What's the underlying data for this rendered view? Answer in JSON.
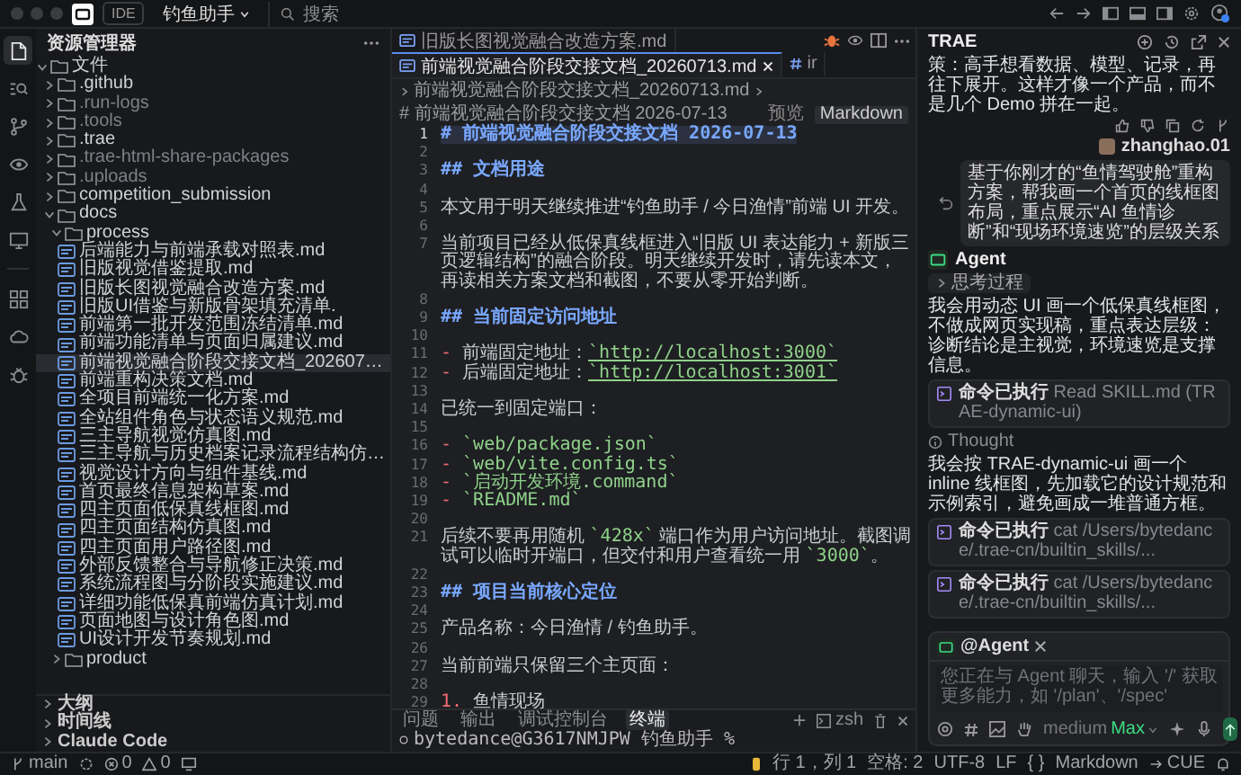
{
  "titlebar": {
    "tag": "IDE",
    "project": "钓鱼助手",
    "search": "搜索"
  },
  "activity_bar": [
    {
      "selected": true
    },
    {
      "selected": false
    },
    {
      "selected": false
    },
    {
      "selected": false
    },
    {
      "selected": false
    },
    {
      "selected": false
    },
    {
      "selected": false
    },
    {
      "selected": false
    },
    {
      "selected": false
    }
  ],
  "sidebar": {
    "title": "资源管理器",
    "tree": [
      {
        "name": "文件",
        "kind": "folder",
        "expanded": true,
        "selected": false,
        "ignored": false,
        "children": [
          {
            "name": ".github",
            "kind": "folder",
            "expanded": false,
            "selected": false,
            "ignored": false
          },
          {
            "name": ".run-logs",
            "kind": "folder",
            "expanded": false,
            "selected": false,
            "ignored": true
          },
          {
            "name": ".tools",
            "kind": "folder",
            "expanded": false,
            "selected": false,
            "ignored": true
          },
          {
            "name": ".trae",
            "kind": "folder",
            "expanded": false,
            "selected": false,
            "ignored": false
          },
          {
            "name": ".trae-html-share-packages",
            "kind": "folder",
            "expanded": false,
            "selected": false,
            "ignored": true
          },
          {
            "name": ".uploads",
            "kind": "folder",
            "expanded": false,
            "selected": false,
            "ignored": true
          },
          {
            "name": "competition_submission",
            "kind": "folder",
            "expanded": false,
            "selected": false,
            "ignored": false
          },
          {
            "name": "docs",
            "kind": "folder",
            "expanded": true,
            "selected": false,
            "ignored": false,
            "children": [
              {
                "name": "process",
                "kind": "folder",
                "expanded": true,
                "selected": false,
                "ignored": false,
                "children": [
                  {
                    "name": "后端能力与前端承载对照表.md",
                    "kind": "file",
                    "selected": false,
                    "ignored": false
                  },
                  {
                    "name": "旧版视觉借鉴提取.md",
                    "kind": "file",
                    "selected": false,
                    "ignored": false
                  },
                  {
                    "name": "旧版长图视觉融合改造方案.md",
                    "kind": "file",
                    "selected": false,
                    "ignored": false
                  },
                  {
                    "name": "旧版UI借鉴与新版骨架填充清单.",
                    "kind": "file",
                    "selected": false,
                    "ignored": false
                  },
                  {
                    "name": "前端第一批开发范围冻结清单.md",
                    "kind": "file",
                    "selected": false,
                    "ignored": false
                  },
                  {
                    "name": "前端功能清单与页面归属建议.md",
                    "kind": "file",
                    "selected": false,
                    "ignored": false
                  },
                  {
                    "name": "前端视觉融合阶段交接文档_202607…",
                    "kind": "file",
                    "selected": true,
                    "ignored": false
                  },
                  {
                    "name": "前端重构决策文档.md",
                    "kind": "file",
                    "selected": false,
                    "ignored": false
                  },
                  {
                    "name": "全项目前端统一化方案.md",
                    "kind": "file",
                    "selected": false,
                    "ignored": false
                  },
                  {
                    "name": "全站组件角色与状态语义规范.md",
                    "kind": "file",
                    "selected": false,
                    "ignored": false
                  },
                  {
                    "name": "三主导航视觉仿真图.md",
                    "kind": "file",
                    "selected": false,
                    "ignored": false
                  },
                  {
                    "name": "三主导航与历史档案记录流程结构仿…",
                    "kind": "file",
                    "selected": false,
                    "ignored": false
                  },
                  {
                    "name": "视觉设计方向与组件基线.md",
                    "kind": "file",
                    "selected": false,
                    "ignored": false
                  },
                  {
                    "name": "首页最终信息架构草案.md",
                    "kind": "file",
                    "selected": false,
                    "ignored": false
                  },
                  {
                    "name": "四主页面低保真线框图.md",
                    "kind": "file",
                    "selected": false,
                    "ignored": false
                  },
                  {
                    "name": "四主页面结构仿真图.md",
                    "kind": "file",
                    "selected": false,
                    "ignored": false
                  },
                  {
                    "name": "四主页面用户路径图.md",
                    "kind": "file",
                    "selected": false,
                    "ignored": false
                  },
                  {
                    "name": "外部反馈整合与导航修正决策.md",
                    "kind": "file",
                    "selected": false,
                    "ignored": false
                  },
                  {
                    "name": "系统流程图与分阶段实施建议.md",
                    "kind": "file",
                    "selected": false,
                    "ignored": false
                  },
                  {
                    "name": "详细功能低保真前端仿真计划.md",
                    "kind": "file",
                    "selected": false,
                    "ignored": false
                  },
                  {
                    "name": "页面地图与设计角色图.md",
                    "kind": "file",
                    "selected": false,
                    "ignored": false
                  },
                  {
                    "name": "UI设计开发节奏规划.md",
                    "kind": "file",
                    "selected": false,
                    "ignored": false
                  }
                ]
              },
              {
                "name": "product",
                "kind": "folder",
                "expanded": false,
                "selected": false,
                "ignored": false
              }
            ]
          }
        ]
      }
    ],
    "sections": [
      {
        "label": "大纲",
        "expanded": false
      },
      {
        "label": "时间线",
        "expanded": false
      },
      {
        "label": "Claude Code",
        "expanded": false
      }
    ]
  },
  "editor": {
    "tabs": [
      {
        "label": "旧版长图视觉融合改造方案.md",
        "kind": "markdown",
        "selected": false
      },
      {
        "label": "前端视觉融合阶段交接文档_20260713.md",
        "kind": "markdown",
        "selected": true
      },
      {
        "label": "ir",
        "kind": "hash",
        "selected": false
      }
    ],
    "breadcrumb": [
      "前端视觉融合阶段交接文档_20260713.md",
      "# 前端视觉融合阶段交接文档 2026-07-13"
    ],
    "view_buttons": [
      "预览",
      "Markdown"
    ],
    "lines": [
      {
        "n": "1",
        "kind": "h1",
        "text": "# 前端视觉融合阶段交接文档 2026-07-13"
      },
      {
        "n": "2",
        "kind": "blank"
      },
      {
        "n": "3",
        "kind": "h2",
        "text": "## 文档用途"
      },
      {
        "n": "4",
        "kind": "blank"
      },
      {
        "n": "5",
        "kind": "p",
        "parts": [
          {
            "kind": "plain",
            "text": "本文用于明天继续推进“钓鱼助手 / 今日渔情”前端 UI 开发。"
          }
        ]
      },
      {
        "n": "6",
        "kind": "blank"
      },
      {
        "n": "7",
        "kind": "p",
        "parts": [
          {
            "kind": "plain",
            "text": "当前项目已经从低保真线框进入“旧版 UI 表达能力 + 新版三页逻辑结构”的融合阶段。明天继续开发时，请先读本文，再读相关方案文档和截图，不要从零开始判断。"
          }
        ]
      },
      {
        "n": "8",
        "kind": "blank"
      },
      {
        "n": "9",
        "kind": "h2",
        "text": "## 当前固定访问地址"
      },
      {
        "n": "10",
        "kind": "blank"
      },
      {
        "n": "11",
        "kind": "bullet",
        "marker": "-",
        "parts": [
          {
            "kind": "plain",
            "text": "前端固定地址："
          },
          {
            "kind": "link",
            "text": "`http://localhost:3000`"
          }
        ]
      },
      {
        "n": "12",
        "kind": "bullet",
        "marker": "-",
        "parts": [
          {
            "kind": "plain",
            "text": "后端固定地址："
          },
          {
            "kind": "link",
            "text": "`http://localhost:3001`"
          }
        ]
      },
      {
        "n": "13",
        "kind": "blank"
      },
      {
        "n": "14",
        "kind": "p",
        "parts": [
          {
            "kind": "plain",
            "text": "已统一到固定端口："
          }
        ]
      },
      {
        "n": "15",
        "kind": "blank"
      },
      {
        "n": "16",
        "kind": "bullet",
        "marker": "-",
        "parts": [
          {
            "kind": "code",
            "text": "`web/package.json`"
          }
        ]
      },
      {
        "n": "17",
        "kind": "bullet",
        "marker": "-",
        "parts": [
          {
            "kind": "code",
            "text": "`web/vite.config.ts`"
          }
        ]
      },
      {
        "n": "18",
        "kind": "bullet",
        "marker": "-",
        "parts": [
          {
            "kind": "code",
            "text": "`启动开发环境.command`"
          }
        ]
      },
      {
        "n": "19",
        "kind": "bullet",
        "marker": "-",
        "parts": [
          {
            "kind": "code",
            "text": "`README.md`"
          }
        ]
      },
      {
        "n": "20",
        "kind": "blank"
      },
      {
        "n": "21",
        "kind": "p",
        "parts": [
          {
            "kind": "plain",
            "text": "后续不要再用随机 "
          },
          {
            "kind": "code",
            "text": "`428x`"
          },
          {
            "kind": "plain",
            "text": " 端口作为用户访问地址。截图调试可以临时开端口，但交付和用户查看统一用 "
          },
          {
            "kind": "code",
            "text": "`3000`"
          },
          {
            "kind": "plain",
            "text": "。"
          }
        ]
      },
      {
        "n": "22",
        "kind": "blank"
      },
      {
        "n": "23",
        "kind": "h2",
        "text": "## 项目当前核心定位"
      },
      {
        "n": "24",
        "kind": "blank"
      },
      {
        "n": "25",
        "kind": "p",
        "parts": [
          {
            "kind": "plain",
            "text": "产品名称：今日渔情 / 钓鱼助手。"
          }
        ]
      },
      {
        "n": "26",
        "kind": "blank"
      },
      {
        "n": "27",
        "kind": "p",
        "parts": [
          {
            "kind": "plain",
            "text": "当前前端只保留三个主页面："
          }
        ]
      },
      {
        "n": "28",
        "kind": "blank"
      },
      {
        "n": "29",
        "kind": "bullet",
        "marker": "1.",
        "parts": [
          {
            "kind": "plain",
            "text": "鱼情现场"
          }
        ]
      }
    ]
  },
  "panel": {
    "tabs": [
      {
        "label": "问题",
        "selected": false
      },
      {
        "label": "输出",
        "selected": false
      },
      {
        "label": "调试控制台",
        "selected": false
      },
      {
        "label": "终端",
        "selected": true
      }
    ],
    "shell": "zsh",
    "prompt": "bytedance@G3617NMJPW 钓鱼助手 %"
  },
  "chat": {
    "title": "TRAE",
    "messages": [
      {
        "kind": "text",
        "text": "策：高手想看数据、模型、记录，再往下展开。这样才像一个产品，而不是几个 Demo 拼在一起。"
      },
      {
        "kind": "feedback"
      },
      {
        "kind": "user",
        "name": "zhanghao.01",
        "text": "基于你刚才的“鱼情驾驶舱”重构方案，帮我画一个首页的线框图布局，重点展示“AI 鱼情诊断”和“现场环境速览”的层级关系"
      },
      {
        "kind": "agent",
        "name": "Agent"
      },
      {
        "kind": "thinking",
        "label": "思考过程"
      },
      {
        "kind": "text",
        "text": "我会用动态 UI 画一个低保真线框图，不做成网页实现稿，重点表达层级：诊断结论是主视觉，环境速览是支撑信息。"
      },
      {
        "kind": "command",
        "label": "命令已执行",
        "detail": "Read SKILL.md (TRAE-dynamic-ui)"
      },
      {
        "kind": "thought",
        "label": "Thought"
      },
      {
        "kind": "text",
        "text": "我会按 TRAE-dynamic-ui 画一个 inline 线框图，先加载它的设计规范和示例索引，避免画成一堆普通方框。"
      },
      {
        "kind": "command",
        "label": "命令已执行",
        "detail": "cat /Users/bytedance/.trae-cn/builtin_skills/..."
      },
      {
        "kind": "command",
        "label": "命令已执行",
        "detail": "cat /Users/bytedance/.trae-cn/builtin_skills/..."
      }
    ],
    "composer": {
      "mention": "@Agent",
      "placeholder": "您正在与 Agent 聊天，输入 '/' 获取更多能力，如 '/plan'、'/spec'",
      "mode": "medium",
      "badge": "Max"
    }
  },
  "status_bar": {
    "branch": "main",
    "errors": "0",
    "warnings": "0",
    "items": [
      "行 1，列 1",
      "空格: 2",
      "UTF-8",
      "LF",
      "{ }",
      "Markdown"
    ],
    "server": "CUE"
  }
}
